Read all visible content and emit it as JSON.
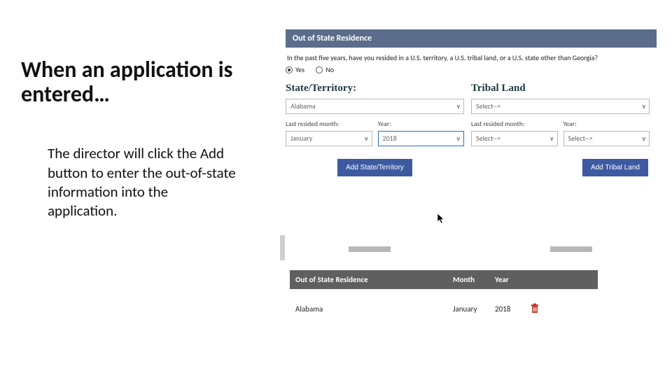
{
  "left": {
    "title": "When an application is entered…",
    "body": "The director will click the Add button to enter the out-of-state information into the application."
  },
  "form": {
    "header": "Out of State Residence",
    "prompt": "In the past five years, have you resided in a U.S. territory, a U.S. tribal land, or a U.S. state other than Georgia?",
    "radio_yes": "Yes",
    "radio_no": "No",
    "state": {
      "heading": "State/Territory:",
      "select_value": "Alabama",
      "month_label": "Last resided month:",
      "month_value": "January",
      "year_label": "Year:",
      "year_value": "2018",
      "add_btn": "Add State/Territory"
    },
    "tribal": {
      "heading": "Tribal Land",
      "select_value": "Select-->",
      "month_label": "Last resided month:",
      "month_value": "Select-->",
      "year_label": "Year:",
      "year_value": "Select-->",
      "add_btn": "Add Tribal Land"
    }
  },
  "table": {
    "col_a": "Out of State Residence",
    "col_b": "Month",
    "col_c": "Year",
    "row": {
      "a": "Alabama",
      "b": "January",
      "c": "2018"
    }
  }
}
